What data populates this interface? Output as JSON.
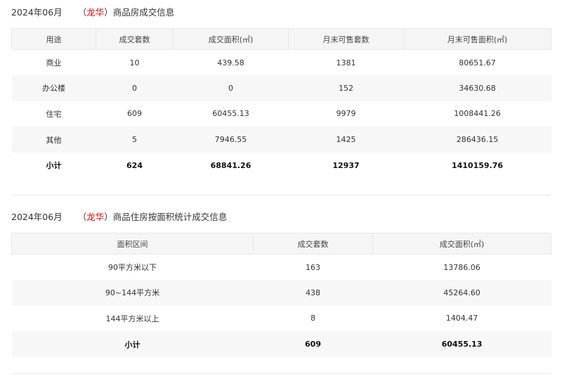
{
  "section1": {
    "title_prefix": "2024年06月",
    "title_open": "（",
    "district": "龙华",
    "title_close": "）",
    "title_suffix": "商品房成交信息",
    "headers": [
      "用途",
      "成交套数",
      "成交面积(㎡)",
      "月末可售套数",
      "月末可售面积(㎡)"
    ],
    "rows": [
      [
        "商业",
        "10",
        "439.58",
        "1381",
        "80651.67"
      ],
      [
        "办公楼",
        "0",
        "0",
        "152",
        "34630.68"
      ],
      [
        "住宅",
        "609",
        "60455.13",
        "9979",
        "1008441.26"
      ],
      [
        "其他",
        "5",
        "7946.55",
        "1425",
        "286436.15"
      ]
    ],
    "total": [
      "小计",
      "624",
      "68841.26",
      "12937",
      "1410159.76"
    ]
  },
  "section2": {
    "title_prefix": "2024年06月",
    "title_open": "（",
    "district": "龙华",
    "title_close": "）",
    "title_suffix": "商品住房按面积统计成交信息",
    "headers": [
      "面积区间",
      "成交套数",
      "成交面积(㎡)"
    ],
    "rows": [
      [
        "90平方米以下",
        "163",
        "13786.06"
      ],
      [
        "90~144平方米",
        "438",
        "45264.60"
      ],
      [
        "144平方米以上",
        "8",
        "1404.47"
      ]
    ],
    "total": [
      "小计",
      "609",
      "60455.13"
    ]
  }
}
